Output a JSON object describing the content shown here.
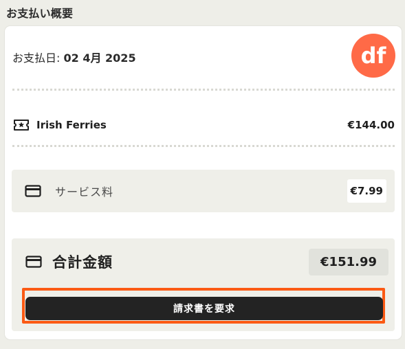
{
  "section": {
    "title": "お支払い概要"
  },
  "payment": {
    "date_label": "お支払日:",
    "date_value": "02 4月 2025",
    "logo_text": "df"
  },
  "ticket": {
    "icon": "ticket-star-icon",
    "name": "Irish Ferries",
    "price": "€144.00"
  },
  "fee": {
    "icon": "credit-card-icon",
    "label": "サービス料",
    "amount": "€7.99"
  },
  "total": {
    "icon": "credit-card-icon",
    "label": "合計金額",
    "amount": "€151.99",
    "button_label": "請求書を要求"
  },
  "colors": {
    "background": "#eeeee8",
    "logo": "#ff6a47",
    "highlight": "#fb5a14",
    "button": "#232323"
  }
}
